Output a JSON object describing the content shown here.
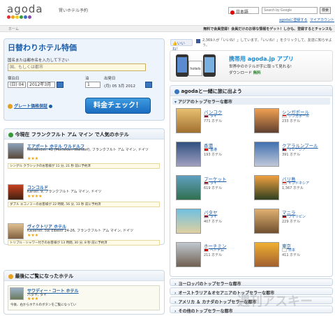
{
  "header": {
    "logo": "agoda",
    "tagline": "賢いホテル予約",
    "language": "日本語",
    "search_placeholder": "Search by Google",
    "search_button": "検索",
    "links": [
      "agodaに登録する",
      "マイアカウント"
    ]
  },
  "breadcrumb": "ホーム",
  "promo_line": "無料で会員登録！会員だけのお得な情報をゲット！しかも、登録するとチャンスも",
  "booking": {
    "title": "日替わりホテル特価",
    "prompt": "国名または都市名を入力して下さい",
    "placeholder": "国、もしくは都市",
    "checkin_label": "宿泊日",
    "nights_label": "泊",
    "checkout_label": "出発日",
    "day": "(日) 04",
    "month": "2012年3月",
    "nights": "1",
    "checkout_value": "(月) 05 3月 2012",
    "guarantee": "グレート価格保証",
    "check_button": "料金チェック！"
  },
  "popular": {
    "title": "今現在 フランクフルト アム マイン で人気のホテル",
    "hotels": [
      {
        "name": "エアポート ホテル ワルドルフ",
        "address": "Nordendstr. 42 (Morfelden-Walldorf), フランクフルト アム マイン, ドイツ",
        "stars": "★★★",
        "note": "シングル クラシックのお客様が 11 分, 21 秒 前に予約済"
      },
      {
        "name": "コンコルド",
        "address": "Karlstr. 9, フランクフルト アム マイン, ドイツ",
        "stars": "★★★★",
        "note": "ダブル エコノミーのお客様が 22 時間, 56 分, 33 秒 前に予約済"
      },
      {
        "name": "ヴィクトリア ホテル",
        "address": "Kaiserstr. 59/ Elbestr 24-26, フランクフルト アム マイン, ドイツ",
        "stars": "★★★",
        "note": "トリプル - シャワー付きのお客様が 13 時間, 30 分, 8 秒 前に予約済"
      }
    ]
  },
  "recent": {
    "title": "最後にご覧になったホテル",
    "hotel": {
      "name": "サワディー・コート ホテル",
      "location": "バタヤ, タイ",
      "stars": "★★★",
      "note": "今後、右からホテルのボタンをご覧になってい"
    }
  },
  "social": {
    "like": "いいね！",
    "text": "2,369人が「いいね！」しています。「いいね！」をクリックして、友達に知らせよう。"
  },
  "mobile": {
    "title": "携帯用 agoda.jp アプリ",
    "line1": "世界中のホテルが手に取って見れる!",
    "line2": "ダウンロード",
    "line2b": "無料",
    "phone_label": "hotels"
  },
  "explore": {
    "title": "agodaと一緒に旅に出よう",
    "section": "アジアのトップセラーな都市",
    "cities": [
      {
        "name": "バンコク",
        "country": "タイ",
        "count": "771 ホテル"
      },
      {
        "name": "シンガポール",
        "country": "シンガポール",
        "count": "233 ホテル"
      },
      {
        "name": "香港",
        "country": "香港",
        "count": "193 ホテル"
      },
      {
        "name": "クアラルンプール",
        "country": "マレーシア",
        "count": "391 ホテル"
      },
      {
        "name": "プーケット",
        "country": "タイ",
        "count": "619 ホテル"
      },
      {
        "name": "バリ島",
        "country": "インドネシア",
        "count": "1,367 ホテル"
      },
      {
        "name": "パタヤ",
        "country": "タイ",
        "count": "407 ホテル"
      },
      {
        "name": "マニラ",
        "country": "フィリピン",
        "count": "229 ホテル"
      },
      {
        "name": "ホーチミン",
        "country": "ベトナム",
        "count": "211 ホテル"
      },
      {
        "name": "東京",
        "country": "日本",
        "count": "411 ホテル"
      }
    ],
    "regions": [
      "ヨーロッパのトップセラーな都市",
      "オーストラリア＆オセアニアのトップセラーな都市",
      "アメリカ ＆ カナダのトップセラーな都市",
      "その他のトップセラーな都市"
    ]
  },
  "watermark": "週刊アスキー"
}
